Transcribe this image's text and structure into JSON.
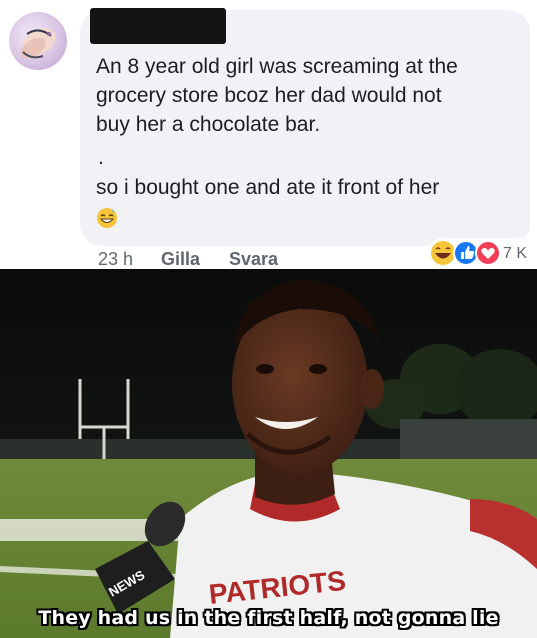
{
  "comment": {
    "author_redacted": true,
    "lines": [
      "An 8 year old girl was screaming at the",
      "grocery store bcoz her dad would not",
      "buy her a chocolate bar."
    ],
    "dot": ".",
    "punchline": "so i bought one and ate it front of her",
    "emoji": "grinning-sweat-emoji",
    "time": "23 h",
    "like_label": "Gilla",
    "reply_label": "Svara",
    "reactions": [
      "haha-reaction",
      "like-reaction",
      "love-reaction"
    ],
    "reaction_count": "7 K",
    "colors": {
      "bubble": "#f0f2f5",
      "text": "#1c1e21",
      "meta": "#606770",
      "like_blue": "#1877f2",
      "love_red": "#f33e58"
    }
  },
  "meme": {
    "caption": "They had us in the first half, not gonna lie",
    "jersey_text": "PATRIOTS",
    "mic_logo": "NEWS"
  }
}
